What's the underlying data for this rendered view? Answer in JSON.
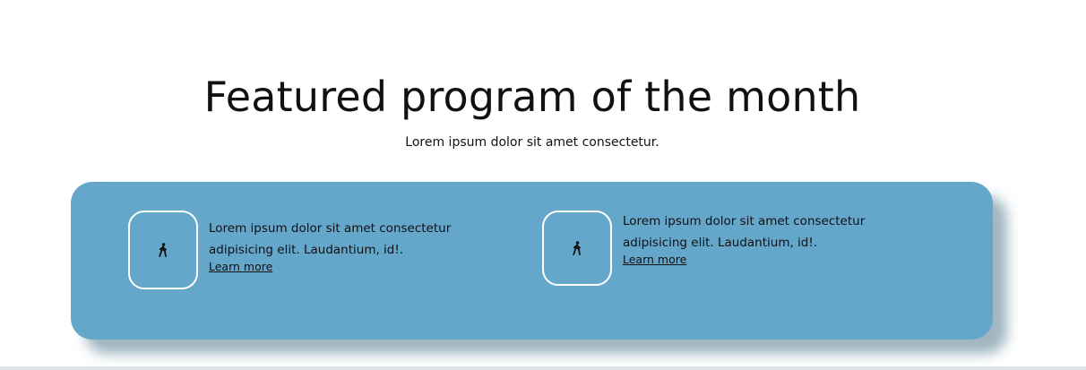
{
  "header": {
    "title": "Featured program of the month",
    "subtitle": "Lorem ipsum dolor sit amet consectetur."
  },
  "colors": {
    "panel_background": "#65a6cb",
    "icon_border": "#ffffff",
    "text": "#111111"
  },
  "cards": [
    {
      "icon": "walking-person-icon",
      "description": "Lorem ipsum dolor sit amet consectetur adipisicing elit. Laudantium, id!.",
      "link_label": "Learn more"
    },
    {
      "icon": "walking-person-icon",
      "description": "Lorem ipsum dolor sit amet consectetur adipisicing elit. Laudantium, id!.",
      "link_label": "Learn more"
    }
  ]
}
